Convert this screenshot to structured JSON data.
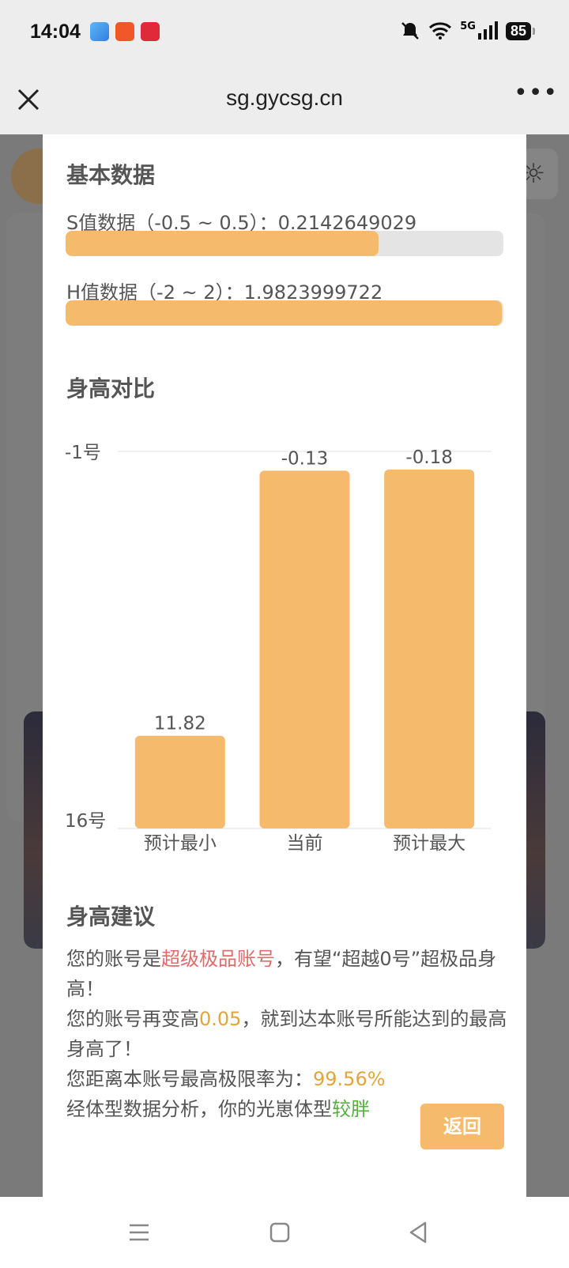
{
  "status_bar": {
    "time": "14:04",
    "network": "5G",
    "battery": "85",
    "app_icons": [
      "photos-app-icon",
      "pinduoduo-app-icon",
      "red-app-icon"
    ]
  },
  "browser": {
    "url": "sg.gycsg.cn",
    "close_icon": "close-icon",
    "more_icon": "more-dots-icon"
  },
  "basic": {
    "title": "基本数据",
    "s_label": "S值数据（-0.5 ~ 0.5）：",
    "s_value": "0.2142649029",
    "s_progress": 0.7143,
    "h_label": "H值数据（-2 ~ 2）：",
    "h_value": "1.9823999722",
    "h_progress": 0.9956
  },
  "compare": {
    "title": "身高对比"
  },
  "chart_data": {
    "type": "bar",
    "categories": [
      "预计最小",
      "当前",
      "预计最大"
    ],
    "values": [
      11.82,
      -0.13,
      -0.18
    ],
    "value_labels": [
      "11.82",
      "-0.13",
      "-0.18"
    ],
    "y_axis_labels": [
      "-1号",
      "16号"
    ],
    "ylim": [
      16,
      -1
    ],
    "inverted_axis": true,
    "bar_color": "#f5ba6b"
  },
  "advice": {
    "title": "身高建议",
    "line1_prefix": "您的账号是",
    "line1_highlight": "超级极品账号",
    "line1_suffix": "，有望“超越0号”超极品身高！",
    "line2_prefix": "您的账号再变高",
    "line2_highlight": "0.05",
    "line2_suffix": "，就到达本账号所能达到的最高身高了！",
    "line3_prefix": "您距离本账号最高极限率为：",
    "line3_highlight": "99.56%",
    "line4_prefix": "经体型数据分析，你的光崽体型",
    "line4_highlight": "较胖"
  },
  "buttons": {
    "back": "返回"
  },
  "colors": {
    "accent": "#f5ba6b",
    "highlight_red": "#e06b6b",
    "highlight_orange": "#e3a43a",
    "highlight_green": "#55b040"
  }
}
